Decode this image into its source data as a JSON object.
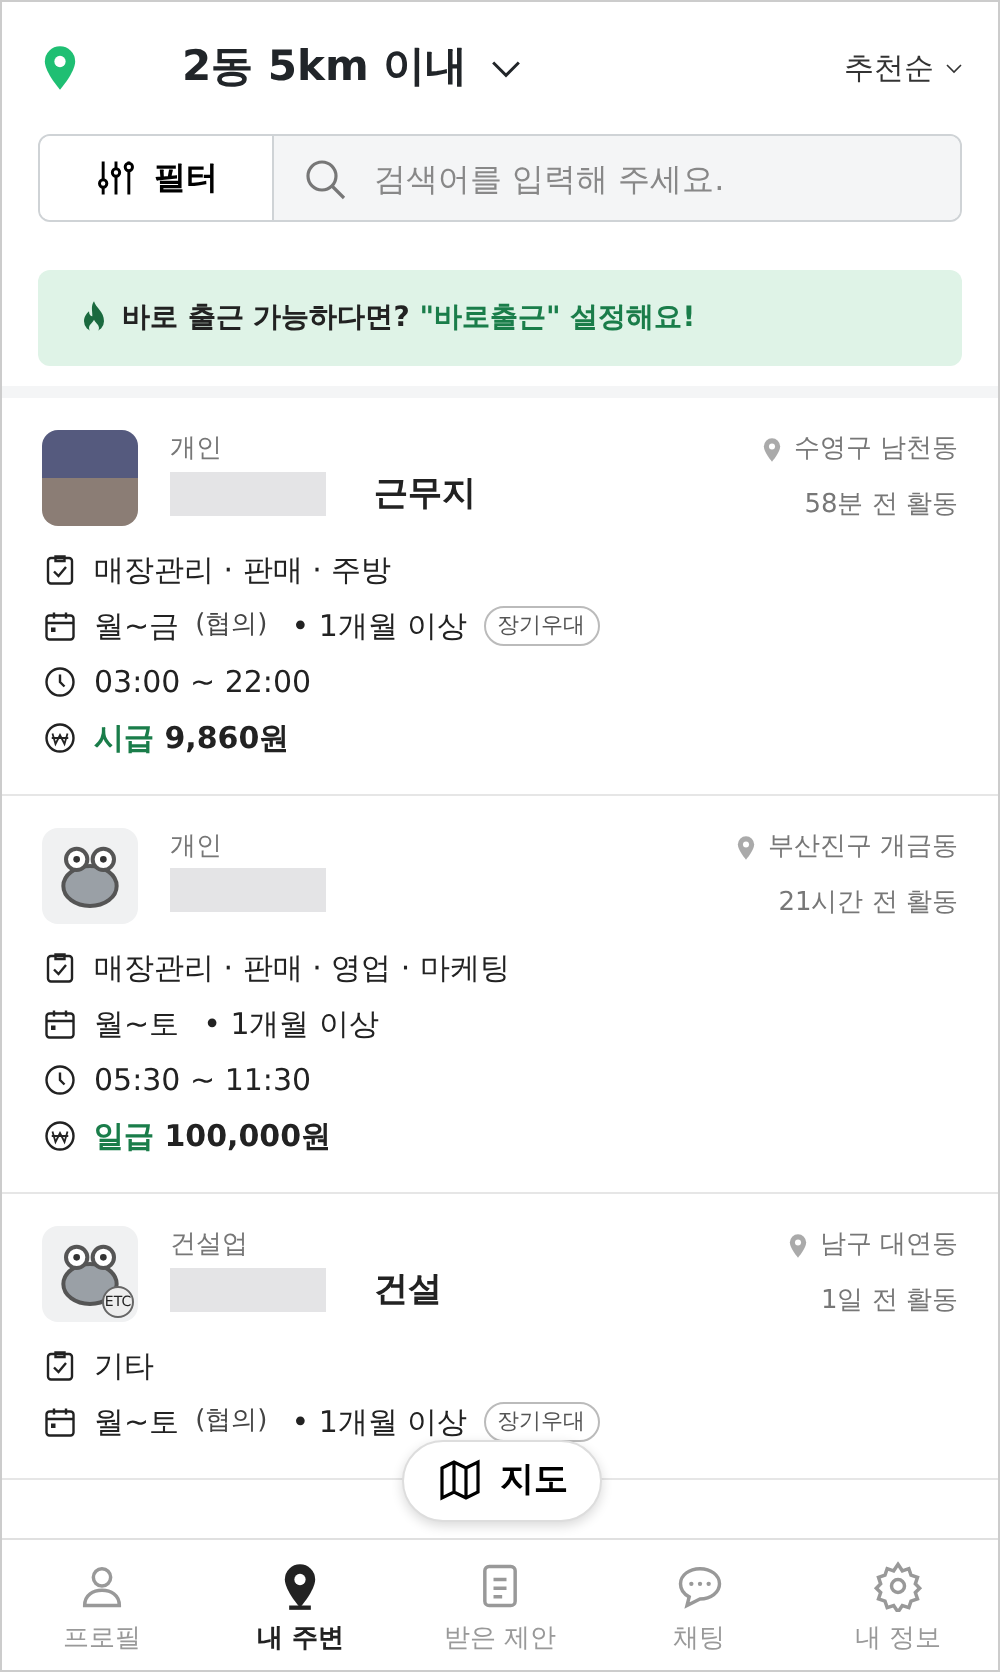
{
  "header": {
    "location": "2동 5km 이내",
    "sort": "추천순"
  },
  "filter_button": "필터",
  "search": {
    "placeholder": "검색어를 입력해 주세요."
  },
  "banner": {
    "text": "바로 출근 가능하다면?",
    "highlight": "\"바로출근\" 설정해요!"
  },
  "jobs": [
    {
      "kind": "photo",
      "category_label": "개인",
      "name": "근무지",
      "name_hidden": true,
      "area": "수영구 남천동",
      "activity": "58분 전 활동",
      "duties": "매장관리 · 판매 · 주방",
      "days": "월~금",
      "days_note": "(협의)",
      "period": "• 1개월 이상",
      "badge": "장기우대",
      "hours": "03:00 ~ 22:00",
      "pay_type": "시급",
      "pay": "9,860원"
    },
    {
      "kind": "mascot",
      "category_label": "개인",
      "name_hidden": true,
      "area": "부산진구 개금동",
      "activity": "21시간 전 활동",
      "duties": "매장관리 · 판매 · 영업 · 마케팅",
      "days": "월~토",
      "period": "• 1개월 이상",
      "hours": "05:30 ~ 11:30",
      "pay_type": "일급",
      "pay": "100,000원"
    },
    {
      "kind": "mascot",
      "logo_badge": "ETC",
      "category_label": "건설업",
      "name": "건설",
      "name_hidden": true,
      "area": "남구 대연동",
      "activity": "1일 전 활동",
      "duties": "기타",
      "days": "월~토",
      "days_note": "(협의)",
      "period": "• 1개월 이상",
      "badge": "장기우대"
    }
  ],
  "map_button": "지도",
  "nav": [
    {
      "kind": "person",
      "label": "프로필",
      "selected": false
    },
    {
      "kind": "pin",
      "label": "내 주변",
      "selected": true
    },
    {
      "kind": "document",
      "label": "받은 제안",
      "selected": false
    },
    {
      "kind": "chat",
      "label": "채팅",
      "selected": false
    },
    {
      "kind": "gear",
      "label": "내 정보",
      "selected": false
    }
  ]
}
